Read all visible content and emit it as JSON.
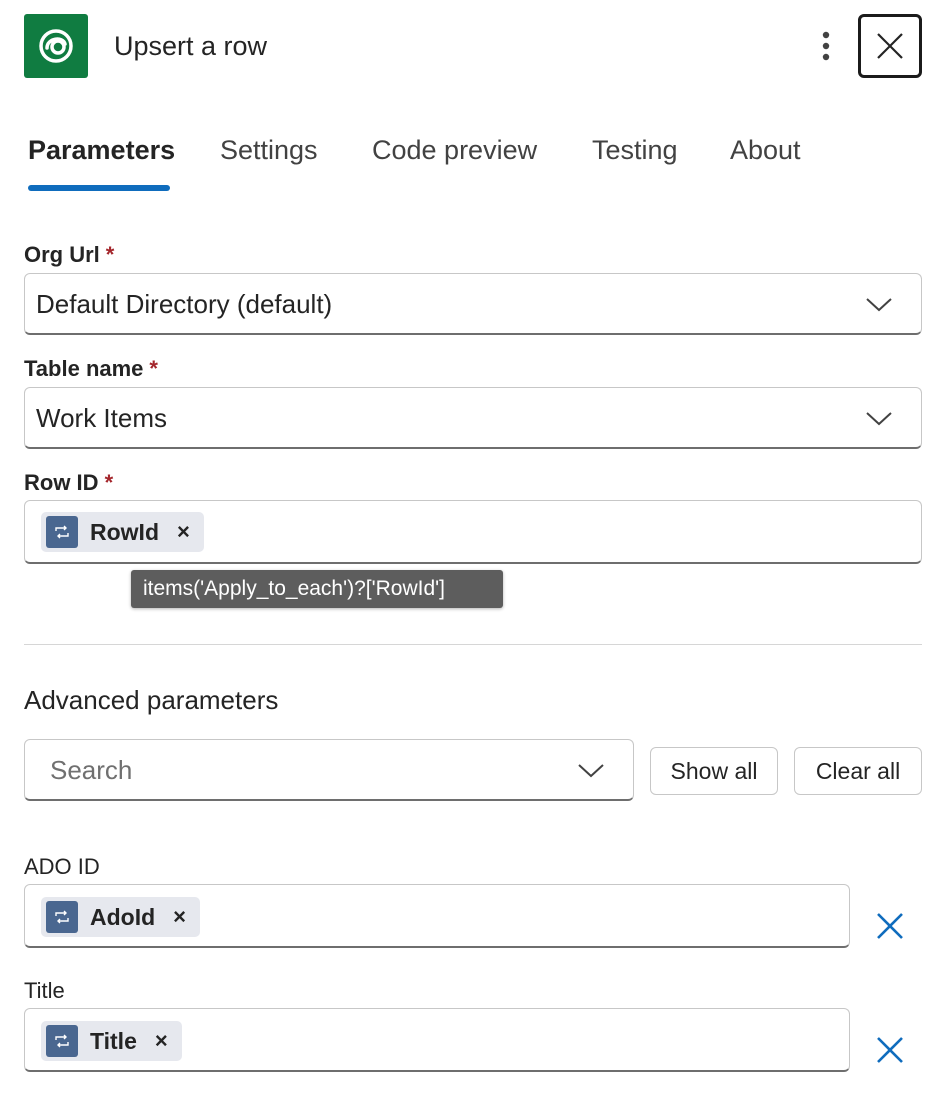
{
  "header": {
    "title": "Upsert a row",
    "app_icon": "dataverse-icon",
    "brand_color": "#107c41"
  },
  "tabs": [
    {
      "label": "Parameters",
      "active": true
    },
    {
      "label": "Settings",
      "active": false
    },
    {
      "label": "Code preview",
      "active": false
    },
    {
      "label": "Testing",
      "active": false
    },
    {
      "label": "About",
      "active": false
    }
  ],
  "fields": {
    "org_url": {
      "label": "Org Url",
      "required_mark": "*",
      "value": "Default Directory (default)"
    },
    "table_name": {
      "label": "Table name",
      "required_mark": "*",
      "value": "Work Items"
    },
    "row_id": {
      "label": "Row ID",
      "required_mark": "*",
      "token": "RowId",
      "token_remove": "×"
    }
  },
  "tooltip": {
    "text": "items('Apply_to_each')?['RowId']"
  },
  "advanced": {
    "title": "Advanced parameters",
    "search_placeholder": "Search",
    "show_all_label": "Show all",
    "clear_all_label": "Clear all",
    "fields": [
      {
        "label": "ADO ID",
        "token": "AdoId",
        "token_remove": "×"
      },
      {
        "label": "Title",
        "token": "Title",
        "token_remove": "×"
      }
    ]
  },
  "colors": {
    "accent": "#0f6cbd",
    "token_icon": "#4a6790",
    "required": "#a4262c"
  }
}
